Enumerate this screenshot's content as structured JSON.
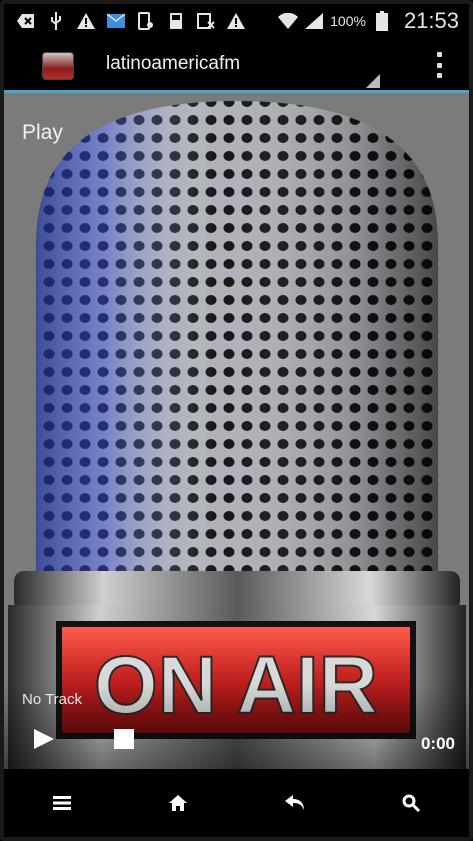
{
  "status_bar": {
    "icons": [
      "add-box-icon",
      "usb-icon",
      "warning-icon",
      "mail-icon",
      "phone-settings-icon",
      "storage-icon",
      "calendar-x-icon",
      "warning-icon",
      "wifi-icon",
      "signal-icon",
      "battery-icon"
    ],
    "battery": "100%",
    "time": "21:53"
  },
  "action_bar": {
    "title": "latinoamericafm"
  },
  "player": {
    "play_label": "Play",
    "track": "No Track",
    "elapsed": "0:00"
  },
  "nav_bar": {
    "items": [
      "menu-icon",
      "home-icon",
      "back-icon",
      "search-icon"
    ]
  },
  "colors": {
    "accent": "#4aa3c8",
    "on_air": "#c0201f"
  }
}
